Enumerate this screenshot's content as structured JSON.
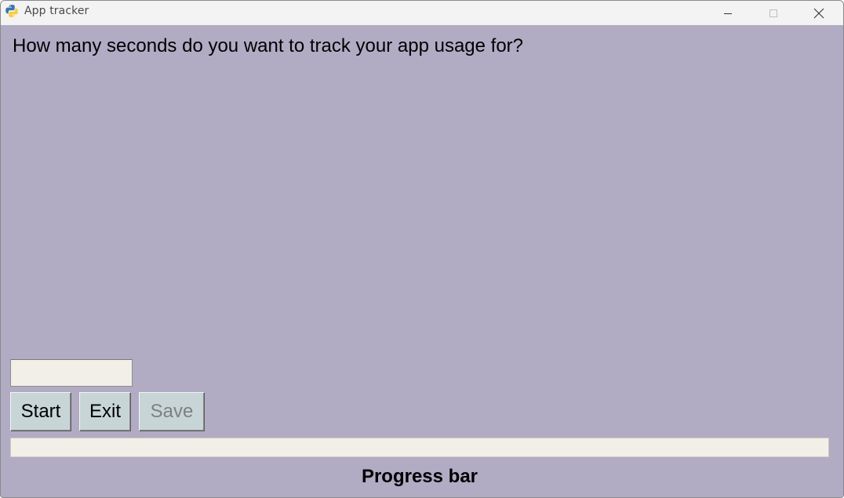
{
  "window": {
    "title": "App tracker",
    "icon": "python-icon"
  },
  "main": {
    "prompt": "How many seconds do you want to track your app usage for?",
    "seconds_input": {
      "value": "",
      "placeholder": ""
    },
    "buttons": {
      "start": "Start",
      "exit": "Exit",
      "save": "Save"
    },
    "progress": {
      "value_percent": 0,
      "label": "Progress bar"
    }
  },
  "colors": {
    "background": "#b1abc4",
    "button": "#c7d5d7",
    "field": "#f2efe8",
    "disabled_text": "#7f7f7f"
  }
}
